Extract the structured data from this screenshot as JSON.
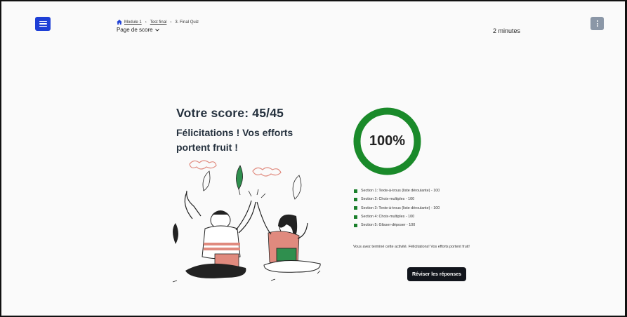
{
  "header": {
    "breadcrumb": [
      {
        "label": "Module 1",
        "link": true
      },
      {
        "label": "Test final",
        "link": true
      },
      {
        "label": "3. Final Quiz",
        "link": false
      }
    ],
    "page_select_label": "Page de score",
    "timer": "2 minutes"
  },
  "result": {
    "score_title": "Votre score: 45/45",
    "congrats": "Félicitations ! Vos efforts portent fruit !",
    "percent_label": "100%",
    "percent_value": 1.0,
    "ring_color": "#1a8a2a"
  },
  "sections": [
    "Section 1: Texte-à-trous (liste déroulante) - 100",
    "Section 2: Choix-multiples - 100",
    "Section 3: Texte-à-trous (liste déroulante) - 100",
    "Section 4: Choix-multiples - 100",
    "Section 5: Glisser-déposer - 100"
  ],
  "completion_text": "Vous avez terminé cette activité. Félicitations! Vos efforts portent fruit!",
  "review_button_label": "Réviser les réponses",
  "colors": {
    "menu_button": "#1e3fd6",
    "more_button": "#8b97a7",
    "section_bullet": "#1a7f2b",
    "review_button": "#12151c"
  },
  "icons": {
    "menu": "hamburger-icon",
    "home": "home-icon",
    "dropdown": "chevron-down-icon",
    "more": "more-vertical-icon"
  }
}
